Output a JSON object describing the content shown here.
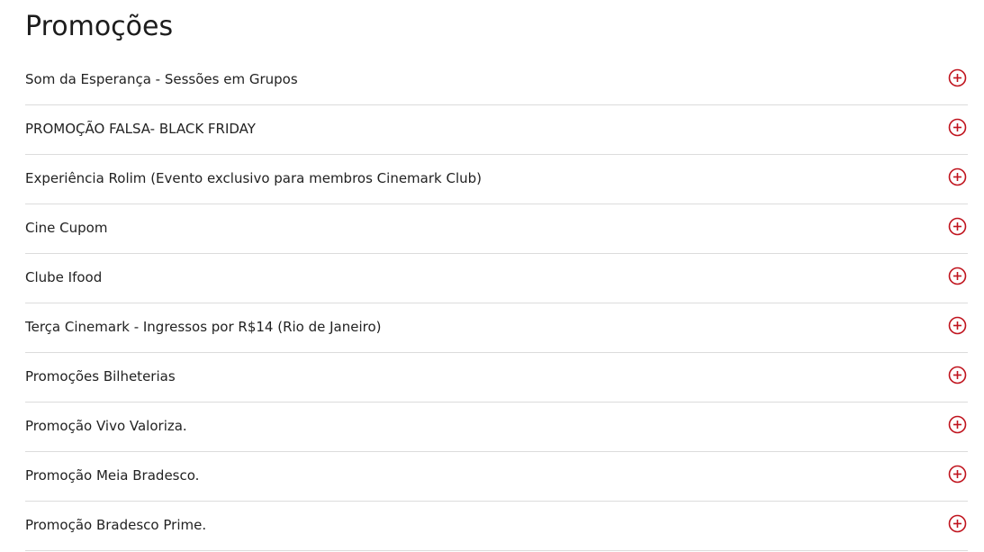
{
  "page": {
    "title": "Promoções"
  },
  "colors": {
    "accent": "#c0141e",
    "divider": "#dcdcdc",
    "text": "#222222"
  },
  "promotions": {
    "items": [
      {
        "label": "Som da Esperança - Sessões em Grupos",
        "icon": "plus-circle-icon"
      },
      {
        "label": "PROMOÇÃO FALSA- BLACK FRIDAY",
        "icon": "plus-circle-icon"
      },
      {
        "label": "Experiência Rolim (Evento exclusivo para membros Cinemark Club)",
        "icon": "plus-circle-icon"
      },
      {
        "label": "Cine Cupom",
        "icon": "plus-circle-icon"
      },
      {
        "label": "Clube Ifood",
        "icon": "plus-circle-icon"
      },
      {
        "label": "Terça Cinemark - Ingressos por R$14 (Rio de Janeiro)",
        "icon": "plus-circle-icon"
      },
      {
        "label": "Promoções Bilheterias",
        "icon": "plus-circle-icon"
      },
      {
        "label": "Promoção Vivo Valoriza.",
        "icon": "plus-circle-icon"
      },
      {
        "label": "Promoção Meia Bradesco.",
        "icon": "plus-circle-icon"
      },
      {
        "label": "Promoção Bradesco Prime.",
        "icon": "plus-circle-icon"
      }
    ]
  }
}
